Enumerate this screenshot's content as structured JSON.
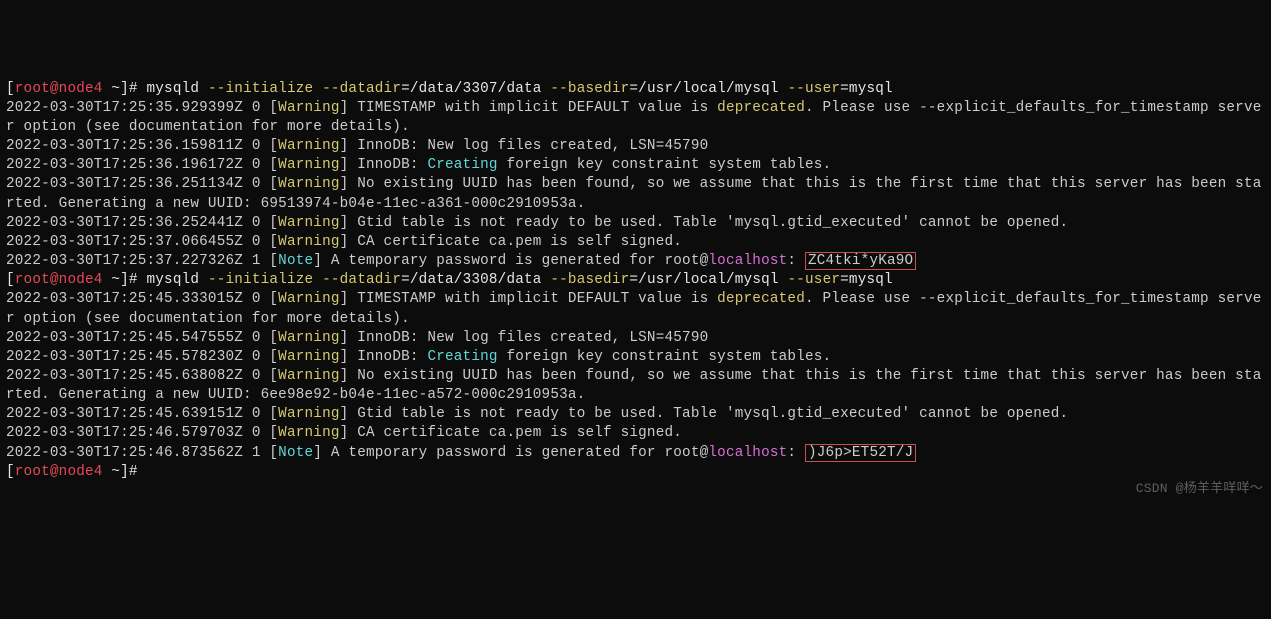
{
  "prompt1": {
    "bracket_open": "[",
    "user_host": "root@node4 ",
    "path": "~",
    "bracket_close": "]#",
    "cmd_bin": " mysqld ",
    "flag1": "--initialize",
    "flag2": " --datadir",
    "val2": "=/data/3307/data ",
    "flag3": "--basedir",
    "val3": "=/usr/local/mysql ",
    "flag4": "--user",
    "val4": "=mysql"
  },
  "lines1": {
    "ts1": "2022-03-30T17:25:35.929399Z 0 [",
    "warn": "Warning",
    "l1a": "] TIMESTAMP with implicit DEFAULT value is ",
    "dep": "deprecated",
    "l1b": ". Please use --explicit_defaults_for_timestamp server option (see documentation for more details).",
    "ts2": "2022-03-30T17:25:36.159811Z 0 [",
    "l2": "] InnoDB: New log files created, LSN=45790",
    "ts3": "2022-03-30T17:25:36.196172Z 0 [",
    "l3a": "] InnoDB: ",
    "creating": "Creating",
    "l3b": " foreign key constraint system tables.",
    "ts4": "2022-03-30T17:25:36.251134Z 0 [",
    "l4": "] No existing UUID has been found, so we assume that this is the first time that this server has been started. Generating a new UUID: 69513974-b04e-11ec-a361-000c2910953a.",
    "ts5": "2022-03-30T17:25:36.252441Z 0 [",
    "l5": "] Gtid table is not ready to be used. Table 'mysql.gtid_executed' cannot be opened.",
    "ts6": "2022-03-30T17:25:37.066455Z 0 [",
    "l6": "] CA certificate ca.pem is self signed.",
    "ts7": "2022-03-30T17:25:37.227326Z 1 [",
    "note": "Note",
    "l7": "] A temporary password is generated for root@",
    "localhost": "localhost",
    "colon": ": ",
    "pwd": "ZC4tki*yKa9O"
  },
  "prompt2": {
    "bracket_open": "[",
    "user_host": "root@node4 ",
    "path": "~",
    "bracket_close": "]#",
    "cmd_bin": " mysqld ",
    "flag1": "--initialize",
    "flag2": " --datadir",
    "val2": "=/data/3308/data ",
    "flag3": "--basedir",
    "val3": "=/usr/local/mysql ",
    "flag4": "--user",
    "val4": "=mysql"
  },
  "lines2": {
    "ts1": "2022-03-30T17:25:45.333015Z 0 [",
    "warn": "Warning",
    "l1a": "] TIMESTAMP with implicit DEFAULT value is ",
    "dep": "deprecated",
    "l1b": ". Please use --explicit_defaults_for_timestamp server option (see documentation for more details).",
    "ts2": "2022-03-30T17:25:45.547555Z 0 [",
    "l2": "] InnoDB: New log files created, LSN=45790",
    "ts3": "2022-03-30T17:25:45.578230Z 0 [",
    "l3a": "] InnoDB: ",
    "creating": "Creating",
    "l3b": " foreign key constraint system tables.",
    "ts4": "2022-03-30T17:25:45.638082Z 0 [",
    "l4": "] No existing UUID has been found, so we assume that this is the first time that this server has been started. Generating a new UUID: 6ee98e92-b04e-11ec-a572-000c2910953a.",
    "ts5": "2022-03-30T17:25:45.639151Z 0 [",
    "l5": "] Gtid table is not ready to be used. Table 'mysql.gtid_executed' cannot be opened.",
    "ts6": "2022-03-30T17:25:46.579703Z 0 [",
    "l6": "] CA certificate ca.pem is self signed.",
    "ts7": "2022-03-30T17:25:46.873562Z 1 [",
    "note": "Note",
    "l7": "] A temporary password is generated for root@",
    "localhost": "localhost",
    "colon": ": ",
    "pwd": ")J6p>ET52T/J"
  },
  "prompt3": {
    "bracket_open": "[",
    "user_host": "root@node4 ",
    "path": "~",
    "bracket_close": "]#"
  },
  "watermark": "CSDN @杨羊羊咩咩～"
}
